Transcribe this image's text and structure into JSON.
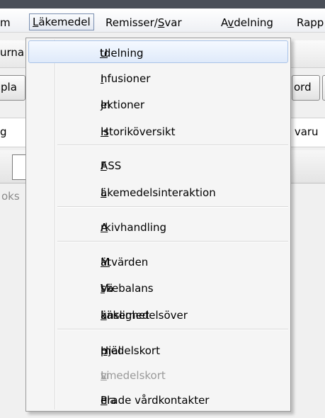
{
  "menubar": {
    "items": [
      {
        "label": "m"
      },
      {
        "label": "Läkemedel",
        "underline": "L"
      },
      {
        "label_pre": "Remisser/",
        "label_u": "S",
        "label_post": "var"
      },
      {
        "label_pre": "A",
        "label_u": "v",
        "label_post": "delning"
      },
      {
        "label": "Rapp"
      }
    ]
  },
  "background": {
    "row1_left": "urna",
    "row2_left": "pla",
    "row2_right": "ord",
    "row3_left": "g",
    "row3_right": ": varu",
    "row5_left": "oks"
  },
  "menu": {
    "items": [
      {
        "u": "U",
        "rest": "tdelning",
        "selected": true
      },
      {
        "u": "I",
        "rest": "nfusioner"
      },
      {
        "pre": "In",
        "u": "j",
        "rest": "ektioner"
      },
      {
        "u": "H",
        "rest": "istoriköversikt"
      },
      {
        "u": "F",
        "rest": "ASS"
      },
      {
        "u": "L",
        "rest": "äkemedelsinteraktion"
      },
      {
        "u": "A",
        "rest": "rkivhandling"
      },
      {
        "u": "M",
        "rest": "ätvärden"
      },
      {
        "pre": "Vä",
        "u": "t",
        "rest": "skebalans"
      },
      {
        "pre": "Läkemedelsöver",
        "u": "k",
        "rest": "änslighet"
      },
      {
        "pre": "Hjäl",
        "u": "p",
        "rest": "medelskort"
      },
      {
        "pre": "Li",
        "u": "v",
        "rest": "smedelskort",
        "disabled": true
      },
      {
        "pre": "Pla",
        "u": "n",
        "rest": "erade vårdkontakter"
      }
    ]
  }
}
